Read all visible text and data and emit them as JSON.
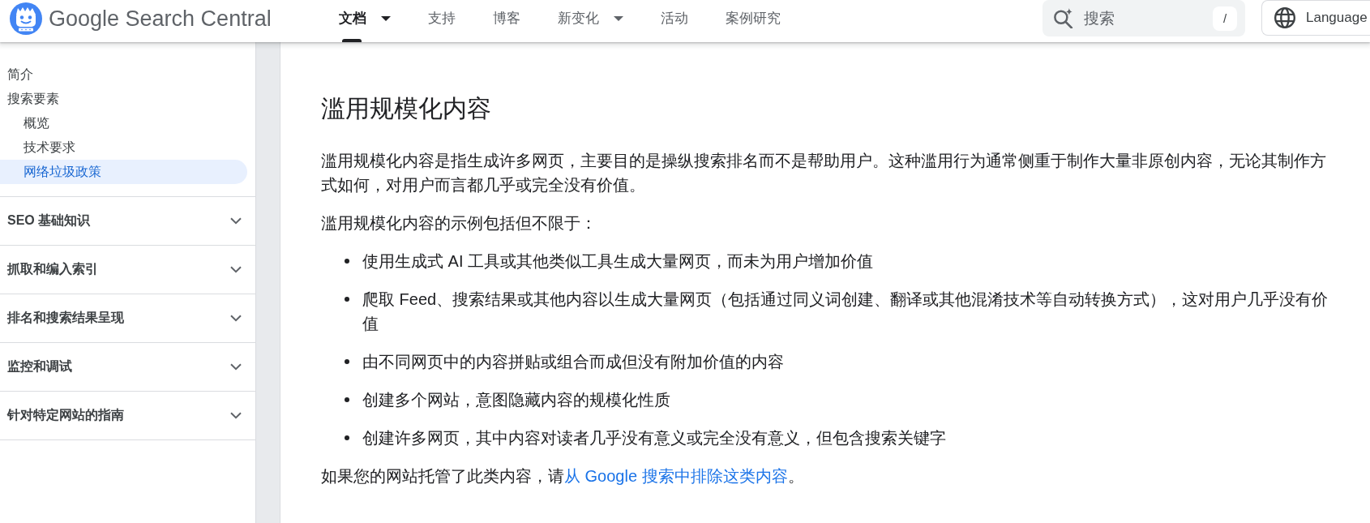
{
  "header": {
    "site_title": "Google Search Central",
    "nav": [
      {
        "label": "文档",
        "selected": true,
        "dropdown": true
      },
      {
        "label": "支持",
        "selected": false,
        "dropdown": false
      },
      {
        "label": "博客",
        "selected": false,
        "dropdown": false
      },
      {
        "label": "新变化",
        "selected": false,
        "dropdown": true
      },
      {
        "label": "活动",
        "selected": false,
        "dropdown": false
      },
      {
        "label": "案例研究",
        "selected": false,
        "dropdown": false
      }
    ],
    "search": {
      "placeholder": "搜索",
      "shortcut": "/"
    },
    "language_button": "Language"
  },
  "sidebar": {
    "items": [
      {
        "label": "简介",
        "selected": false
      },
      {
        "label": "搜索要素",
        "selected": false,
        "children": [
          {
            "label": "概览",
            "selected": false
          },
          {
            "label": "技术要求",
            "selected": false
          },
          {
            "label": "网络垃圾政策",
            "selected": true
          }
        ]
      }
    ],
    "sections": [
      {
        "label": "SEO 基础知识",
        "expanded": false
      },
      {
        "label": "抓取和编入索引",
        "expanded": false
      },
      {
        "label": "排名和搜索结果呈现",
        "expanded": false
      },
      {
        "label": "监控和调试",
        "expanded": false
      },
      {
        "label": "针对特定网站的指南",
        "expanded": false
      }
    ]
  },
  "article": {
    "title": "滥用规模化内容",
    "intro": "滥用规模化内容是指生成许多网页，主要目的是操纵搜索排名而不是帮助用户。这种滥用行为通常侧重于制作大量非原创内容，无论其制作方式如何，对用户而言都几乎或完全没有价值。",
    "list_intro": "滥用规模化内容的示例包括但不限于：",
    "examples": [
      "使用生成式 AI 工具或其他类似工具生成大量网页，而未为用户增加价值",
      "爬取 Feed、搜索结果或其他内容以生成大量网页（包括通过同义词创建、翻译或其他混淆技术等自动转换方式），这对用户几乎没有价值",
      "由不同网页中的内容拼贴或组合而成但没有附加价值的内容",
      "创建多个网站，意图隐藏内容的规模化性质",
      "创建许多网页，其中内容对读者几乎没有意义或完全没有意义，但包含搜索关键字"
    ],
    "note": {
      "text": "如果您的网站托管了此类内容，请",
      "link": "从 Google 搜索中排除这类内容",
      "end": "。"
    }
  }
}
